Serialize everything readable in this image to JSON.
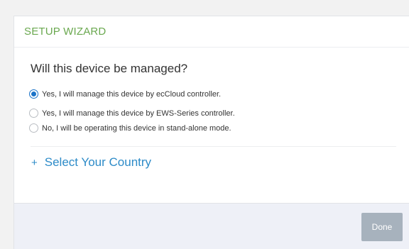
{
  "wizard": {
    "title": "SETUP WIZARD",
    "question": "Will this device be managed?",
    "options": [
      {
        "label": "Yes, I will manage this device by ecCloud controller.",
        "selected": true
      },
      {
        "label": "Yes, I will manage this device by EWS-Series controller.",
        "selected": false
      },
      {
        "label": "No, I will be operating this device in stand-alone mode.",
        "selected": false
      }
    ],
    "country_link": {
      "icon": "plus",
      "label": "Select Your Country"
    },
    "done_label": "Done"
  },
  "colors": {
    "title": "#6aa84f",
    "link": "#2d8bc8",
    "radio_selected": "#1a73c8",
    "done_button": "#a7b2bd",
    "footer_bg": "#eef0f7"
  }
}
